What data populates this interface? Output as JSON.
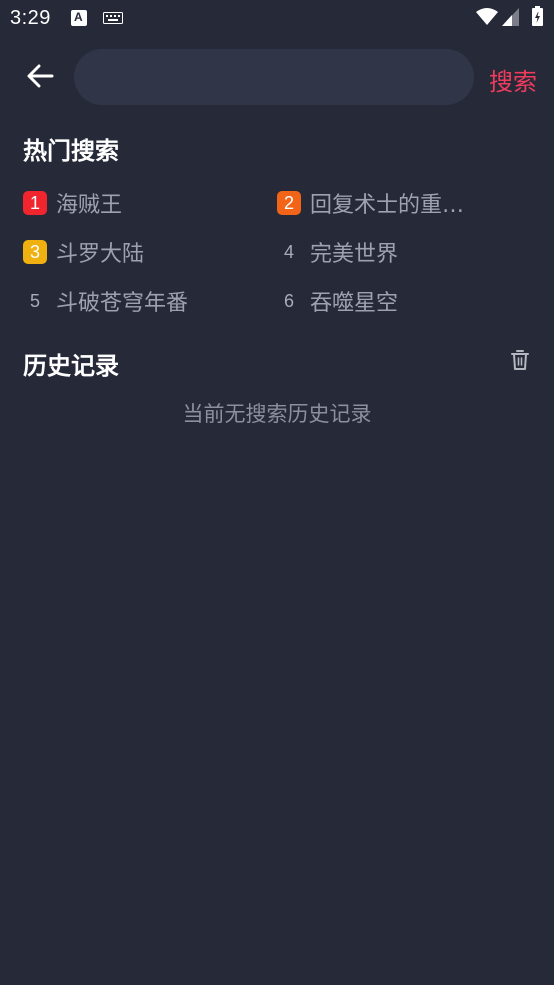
{
  "status_bar": {
    "time": "3:29",
    "notification_letter": "A"
  },
  "header": {
    "search_placeholder": "",
    "search_button_label": "搜索"
  },
  "hot_search": {
    "title": "热门搜索",
    "items": [
      {
        "rank": "1",
        "label": "海贼王",
        "badge_color": "#f0252e"
      },
      {
        "rank": "2",
        "label": "回复术士的重…",
        "badge_color": "#f26418"
      },
      {
        "rank": "3",
        "label": "斗罗大陆",
        "badge_color": "#f0b010"
      },
      {
        "rank": "4",
        "label": "完美世界",
        "badge_color": ""
      },
      {
        "rank": "5",
        "label": "斗破苍穹年番",
        "badge_color": ""
      },
      {
        "rank": "6",
        "label": "吞噬星空",
        "badge_color": ""
      }
    ]
  },
  "history": {
    "title": "历史记录",
    "empty_text": "当前无搜索历史记录"
  },
  "colors": {
    "background": "#252938",
    "accent": "#f03c5c",
    "input_background": "#303548"
  }
}
